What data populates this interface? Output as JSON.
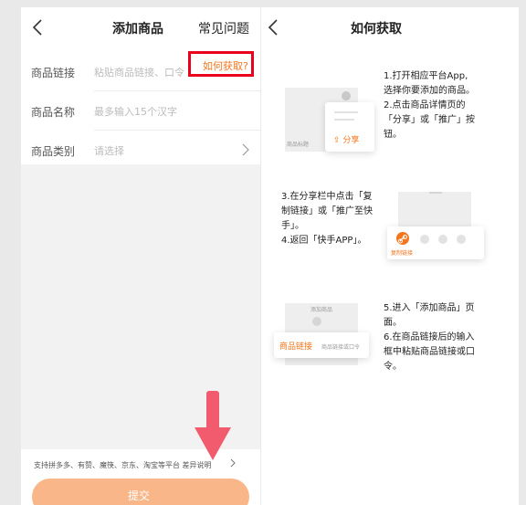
{
  "left": {
    "title": "添加商品",
    "faq": "常见问题",
    "fields": [
      {
        "label": "商品链接",
        "placeholder": "粘贴商品链接、口令"
      },
      {
        "label": "商品名称",
        "placeholder": "最多输入15个汉字"
      },
      {
        "label": "商品类别",
        "placeholder": "请选择"
      }
    ],
    "how_to_get": "如何获取?",
    "support_text": "支持拼多多、有赞、魔筷、京东、淘宝等平台  差异说明",
    "submit_label": "提交"
  },
  "right": {
    "title": "如何获取",
    "step1": [
      "1.打开相应平台App,",
      "选择你要添加的商品。",
      "2.点击商品详情页的",
      "「分享」或「推广」按",
      "钮。"
    ],
    "share_label": "分享",
    "product_title_label": "商品标题",
    "step2": [
      "3.在分享栏中点击「复",
      "制链接」或「推广至快",
      "手」。",
      "4.返回「快手APP」。"
    ],
    "copy_link_label": "复制链接",
    "step3": [
      "5.进入「添加商品」页",
      "面。",
      "6.在商品链接后的输入",
      "框中粘贴商品链接或口",
      "令。"
    ],
    "add_product_small": "添加商品",
    "product_link_label": "商品链接",
    "paste_placeholder": "商品链接或口令"
  },
  "colors": {
    "accent": "#f5751d",
    "highlight_border": "#e8001c",
    "submit_bg": "#f9b689",
    "arrow": "#f25a6e"
  }
}
